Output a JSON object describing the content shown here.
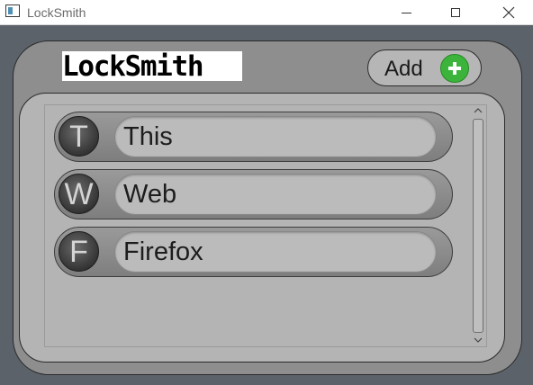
{
  "window": {
    "title": "LockSmith"
  },
  "header": {
    "logo_text": "LockSmith",
    "add_button_label": "Add"
  },
  "entries": [
    {
      "initial": "T",
      "name": "This"
    },
    {
      "initial": "W",
      "name": "Web"
    },
    {
      "initial": "F",
      "name": "Firefox"
    }
  ],
  "colors": {
    "background": "#5b626a",
    "outer_panel": "#8e8e8e",
    "inner_panel": "#b4b4b4",
    "add_icon": "#3cb43c"
  }
}
